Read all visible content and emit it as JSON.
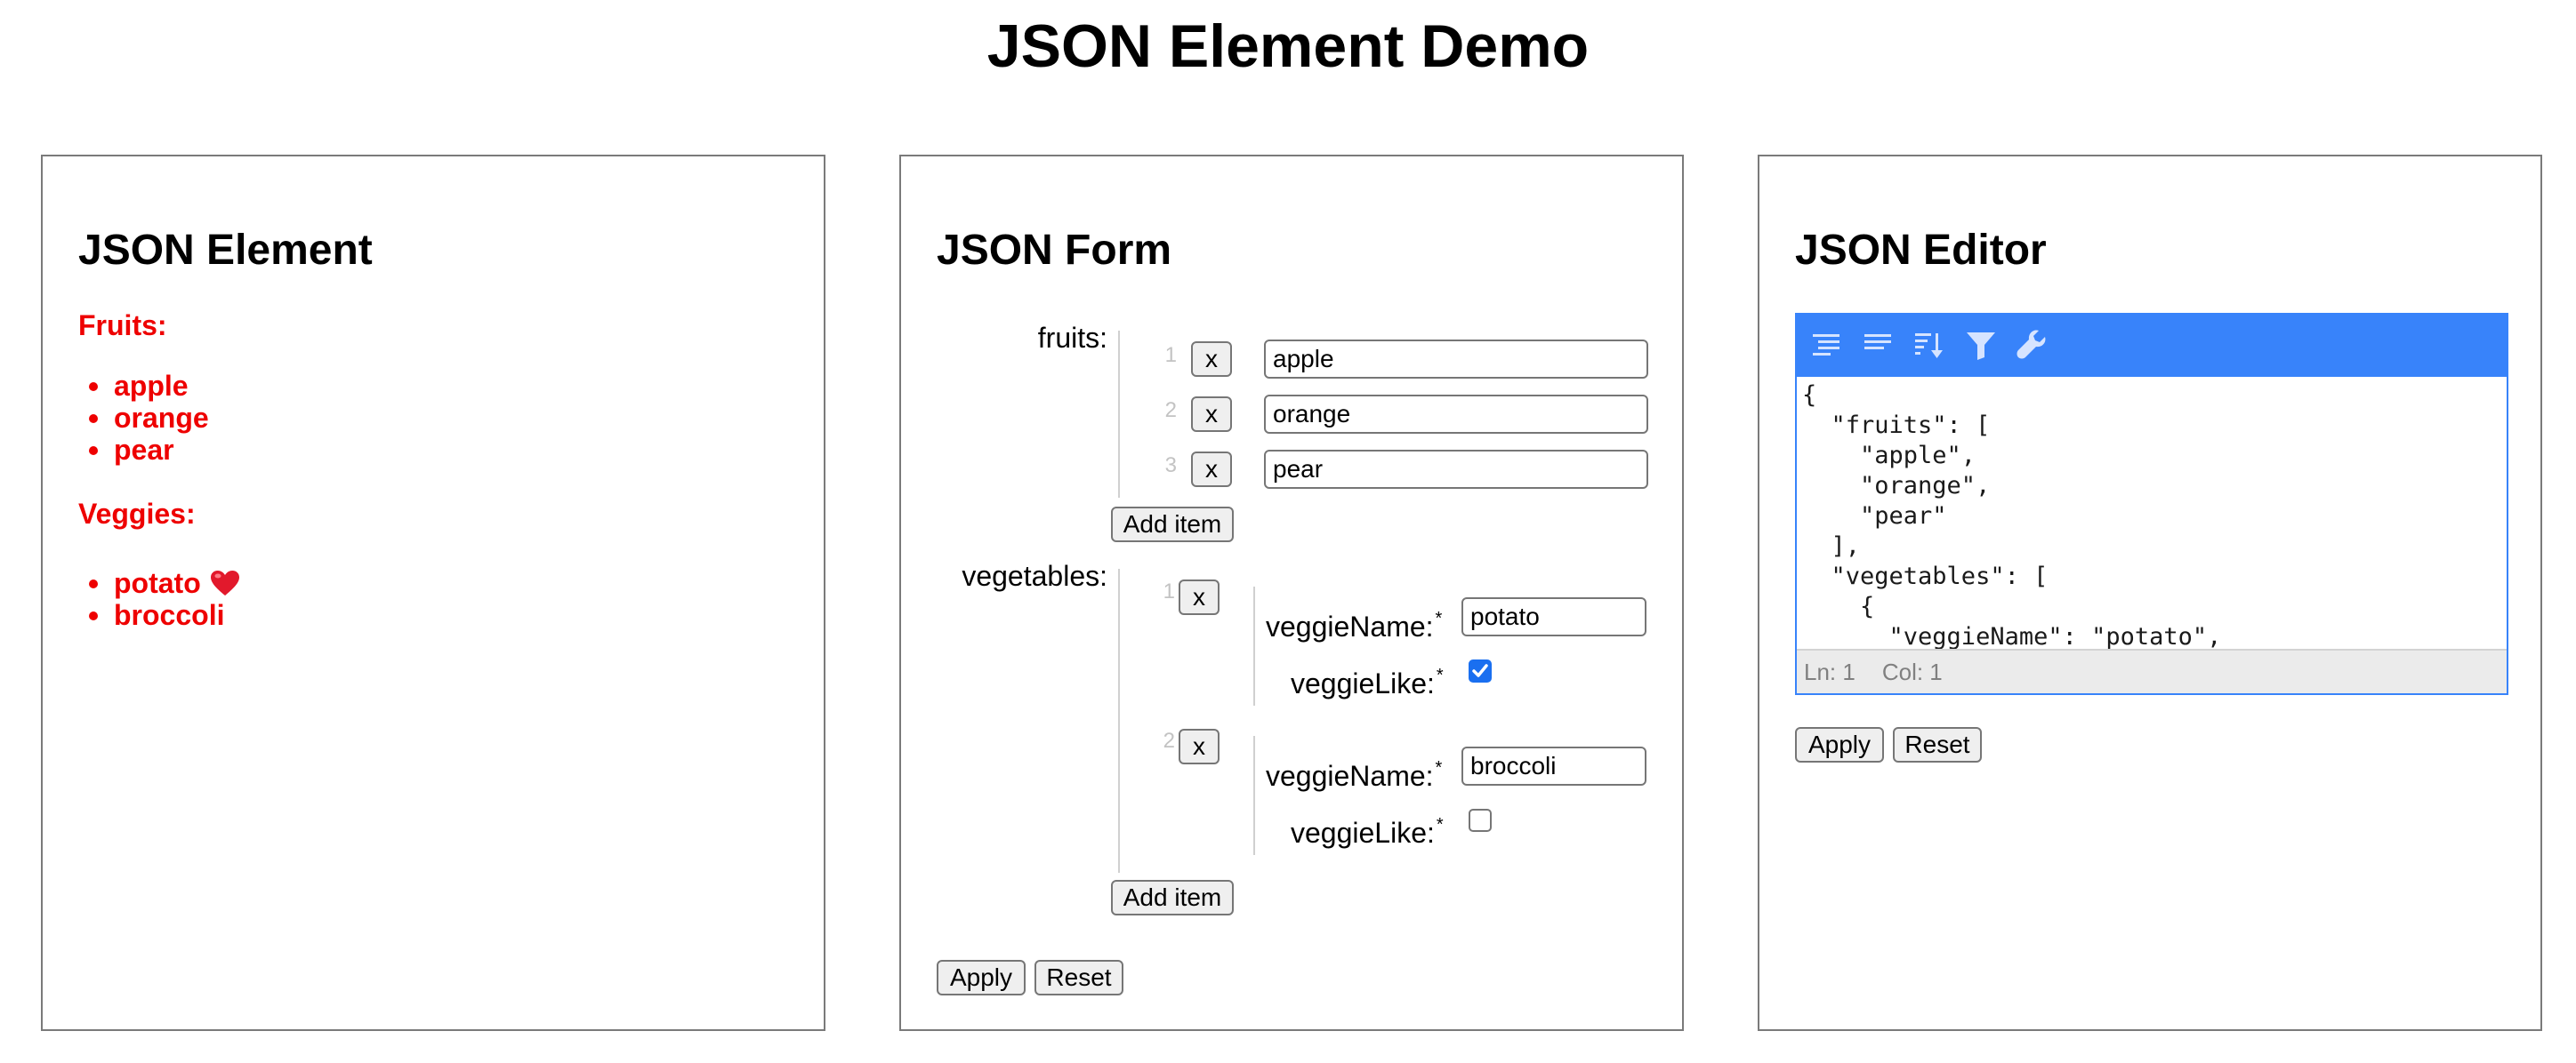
{
  "page": {
    "title": "JSON Element Demo"
  },
  "element_panel": {
    "heading": "JSON Element",
    "fruits_label": "Fruits:",
    "fruits": [
      "apple",
      "orange",
      "pear"
    ],
    "veggies_label": "Veggies:",
    "veggies": [
      "potato",
      "broccoli"
    ],
    "accent_color": "#ee0000"
  },
  "form_panel": {
    "heading": "JSON Form",
    "fruits_label": "fruits:",
    "fruits": [
      {
        "index": "1",
        "remove_label": "x",
        "value": "apple"
      },
      {
        "index": "2",
        "remove_label": "x",
        "value": "orange"
      },
      {
        "index": "3",
        "remove_label": "x",
        "value": "pear"
      }
    ],
    "add_item_label": "Add item",
    "vegetables_label": "vegetables:",
    "vegetables": [
      {
        "index": "1",
        "remove_label": "x",
        "name_label": "veggieName:",
        "name_value": "potato",
        "like_label": "veggieLike:",
        "like_checked": true
      },
      {
        "index": "2",
        "remove_label": "x",
        "name_label": "veggieName:",
        "name_value": "broccoli",
        "like_label": "veggieLike:",
        "like_checked": false
      }
    ],
    "required_mark": "*",
    "apply_label": "Apply",
    "reset_label": "Reset"
  },
  "editor_panel": {
    "heading": "JSON Editor",
    "toolbar_icons": [
      "format-icon",
      "compact-icon",
      "sort-icon",
      "filter-icon",
      "repair-icon"
    ],
    "code_lines": [
      "{",
      "  \"fruits\": [",
      "    \"apple\",",
      "    \"orange\",",
      "    \"pear\"",
      "  ],",
      "  \"vegetables\": [",
      "    {",
      "      \"veggieName\": \"potato\","
    ],
    "status_line": "Ln: 1",
    "status_col": "Col: 1",
    "apply_label": "Apply",
    "reset_label": "Reset",
    "toolbar_color": "#3883fa"
  }
}
